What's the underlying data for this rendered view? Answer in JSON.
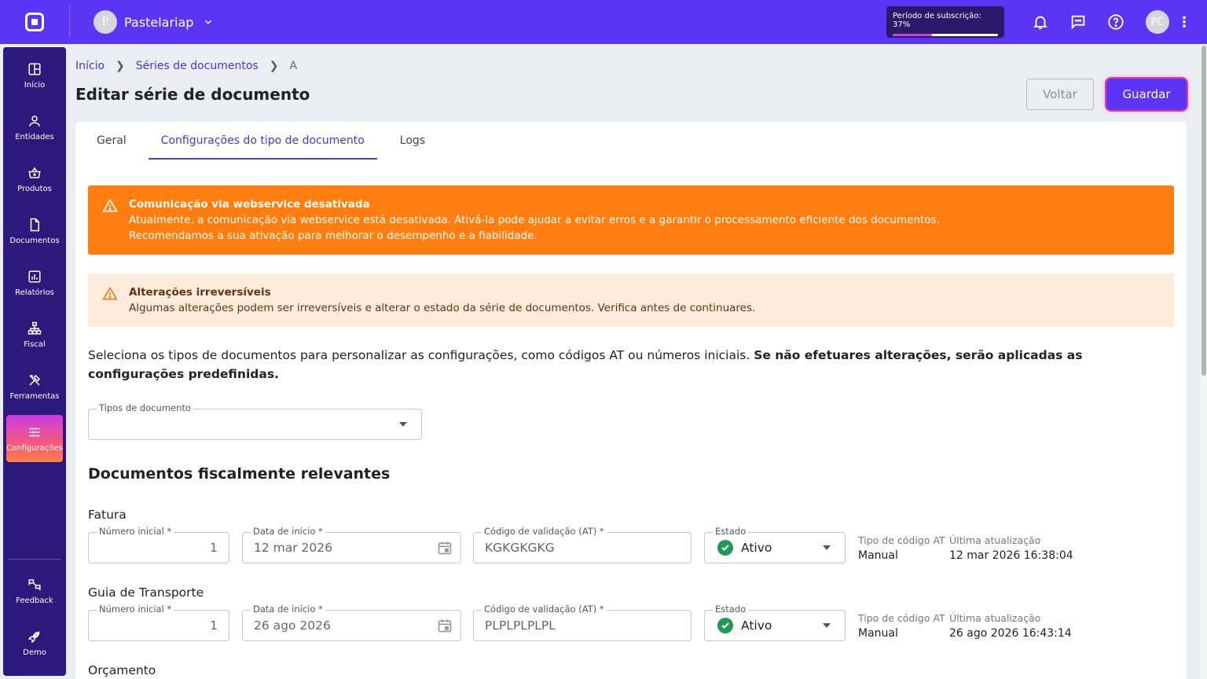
{
  "topbar": {
    "company_initial": "P",
    "company_name": "Pastelariap",
    "subscription_label": "Período de subscrição: 37%",
    "subscription_progress": 0.37,
    "user_initials": "PC"
  },
  "sidebar": {
    "items": [
      {
        "label": "Início"
      },
      {
        "label": "Entidades"
      },
      {
        "label": "Produtos"
      },
      {
        "label": "Documentos"
      },
      {
        "label": "Relatórios"
      },
      {
        "label": "Fiscal"
      },
      {
        "label": "Ferramentas"
      },
      {
        "label": "Configurações"
      },
      {
        "label": "Feedback"
      },
      {
        "label": "Demo"
      }
    ]
  },
  "breadcrumb": {
    "items": [
      "Início",
      "Séries de documentos",
      "A"
    ]
  },
  "page": {
    "title": "Editar série de documento",
    "back_label": "Voltar",
    "save_label": "Guardar"
  },
  "tabs": [
    "Geral",
    "Configurações do tipo de documento",
    "Logs"
  ],
  "alerts": {
    "webservice": {
      "title": "Comunicação via webservice desativada",
      "line1": "Atualmente, a comunicação via webservice está desativada. Ativá-la pode ajudar a evitar erros e a garantir o processamento eficiente dos documentos.",
      "line2": "Recomendamos a sua ativação para melhorar o desempenho e a fiabilidade."
    },
    "irreversible": {
      "title": "Alterações irreversíveis",
      "text": "Algumas alterações podem ser irreversíveis e alterar o estado da série de documentos. Verifica antes de continuares."
    }
  },
  "intro": {
    "text": "Seleciona os tipos de documentos para personalizar as configurações, como códigos AT ou números iniciais. ",
    "bold": "Se não efetuares alterações, serão aplicadas as configurações predefinidas."
  },
  "doc_types_field": {
    "label": "Tipos de documento",
    "value": ""
  },
  "section_title": "Documentos fiscalmente relevantes",
  "labels": {
    "initial_number": "Número inicial *",
    "start_date": "Data de início *",
    "validation_code": "Código de validação (AT) *",
    "status": "Estado",
    "at_code_type": "Tipo de código AT",
    "last_update": "Última atualização"
  },
  "documents": [
    {
      "name": "Fatura",
      "initial_number": "1",
      "start_date": "12 mar 2026",
      "validation_code": "KGKGKGKG",
      "status": "Ativo",
      "at_code_type": "Manual",
      "last_update": "12 mar 2026 16:38:04"
    },
    {
      "name": "Guia de Transporte",
      "initial_number": "1",
      "start_date": "26 ago 2026",
      "validation_code": "PLPLPLPLPL",
      "status": "Ativo",
      "at_code_type": "Manual",
      "last_update": "26 ago 2026 16:43:14"
    },
    {
      "name": "Orçamento"
    }
  ],
  "colors": {
    "primary": "#5b34f5",
    "sidebar": "#2b1a7c",
    "warning": "#ff7e0f",
    "warning_light": "#fdebdc",
    "success": "#1f9a52"
  }
}
